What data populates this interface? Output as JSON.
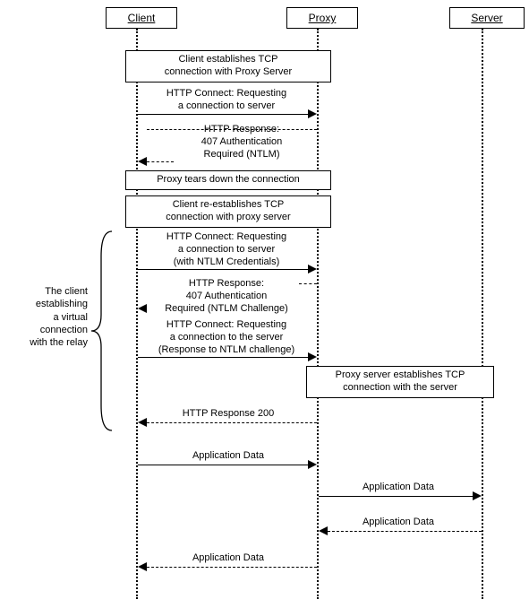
{
  "participants": {
    "client": "Client",
    "proxy": "Proxy",
    "server": "Server"
  },
  "notes": {
    "n1_l1": "Client establishes TCP",
    "n1_l2": "connection with Proxy Server",
    "n2": "Proxy tears down the connection",
    "n3_l1": "Client re-establishes TCP",
    "n3_l2": "connection with proxy server",
    "n4_l1": "Proxy server establishes TCP",
    "n4_l2": "connection with the server"
  },
  "messages": {
    "m1_l1": "HTTP Connect: Requesting",
    "m1_l2": "a connection to server",
    "m2_l1": "HTTP Response:",
    "m2_l2": "407 Authentication",
    "m2_l3": "Required (NTLM)",
    "m3_l1": "HTTP Connect: Requesting",
    "m3_l2": "a connection to server",
    "m3_l3": "(with NTLM Credentials)",
    "m4_l1": "HTTP Response:",
    "m4_l2": "407 Authentication",
    "m4_l3": "Required (NTLM Challenge)",
    "m5_l1": "HTTP Connect: Requesting",
    "m5_l2": "a connection to the server",
    "m5_l3": "(Response to NTLM challenge)",
    "m6": "HTTP Response 200",
    "m7": "Application Data",
    "m8": "Application Data",
    "m9": "Application Data",
    "m10": "Application Data"
  },
  "annotation": {
    "a1_l1": "The client",
    "a1_l2": "establishing",
    "a1_l3": "a virtual",
    "a1_l4": "connection",
    "a1_l5": "with the relay"
  },
  "chart_data": {
    "type": "sequence_diagram",
    "participants": [
      "Client",
      "Proxy",
      "Server"
    ],
    "events": [
      {
        "kind": "note",
        "over": [
          "Client",
          "Proxy"
        ],
        "text": "Client establishes TCP connection with Proxy Server"
      },
      {
        "kind": "message",
        "from": "Client",
        "to": "Proxy",
        "style": "solid",
        "text": "HTTP Connect: Requesting a connection to server"
      },
      {
        "kind": "message",
        "from": "Proxy",
        "to": "Client",
        "style": "dashed",
        "text": "HTTP Response: 407 Authentication Required (NTLM)"
      },
      {
        "kind": "note",
        "over": [
          "Client",
          "Proxy"
        ],
        "text": "Proxy tears down the connection"
      },
      {
        "kind": "note",
        "over": [
          "Client",
          "Proxy"
        ],
        "text": "Client re-establishes TCP connection with proxy server"
      },
      {
        "kind": "message",
        "from": "Client",
        "to": "Proxy",
        "style": "solid",
        "text": "HTTP Connect: Requesting a connection to server (with NTLM Credentials)"
      },
      {
        "kind": "message",
        "from": "Proxy",
        "to": "Client",
        "style": "dashed",
        "text": "HTTP Response: 407 Authentication Required (NTLM Challenge)"
      },
      {
        "kind": "message",
        "from": "Client",
        "to": "Proxy",
        "style": "solid",
        "text": "HTTP Connect: Requesting a connection to the server (Response to NTLM challenge)"
      },
      {
        "kind": "note",
        "over": [
          "Proxy",
          "Server"
        ],
        "text": "Proxy server establishes TCP connection with the server"
      },
      {
        "kind": "message",
        "from": "Proxy",
        "to": "Client",
        "style": "dashed",
        "text": "HTTP Response 200"
      },
      {
        "kind": "message",
        "from": "Client",
        "to": "Proxy",
        "style": "solid",
        "text": "Application Data"
      },
      {
        "kind": "message",
        "from": "Proxy",
        "to": "Server",
        "style": "solid",
        "text": "Application Data"
      },
      {
        "kind": "message",
        "from": "Server",
        "to": "Proxy",
        "style": "dashed",
        "text": "Application Data"
      },
      {
        "kind": "message",
        "from": "Proxy",
        "to": "Client",
        "style": "dashed",
        "text": "Application Data"
      }
    ],
    "side_annotation": {
      "text": "The client establishing a virtual connection with the relay",
      "spans_events": [
        5,
        6,
        7,
        8,
        9
      ]
    }
  }
}
